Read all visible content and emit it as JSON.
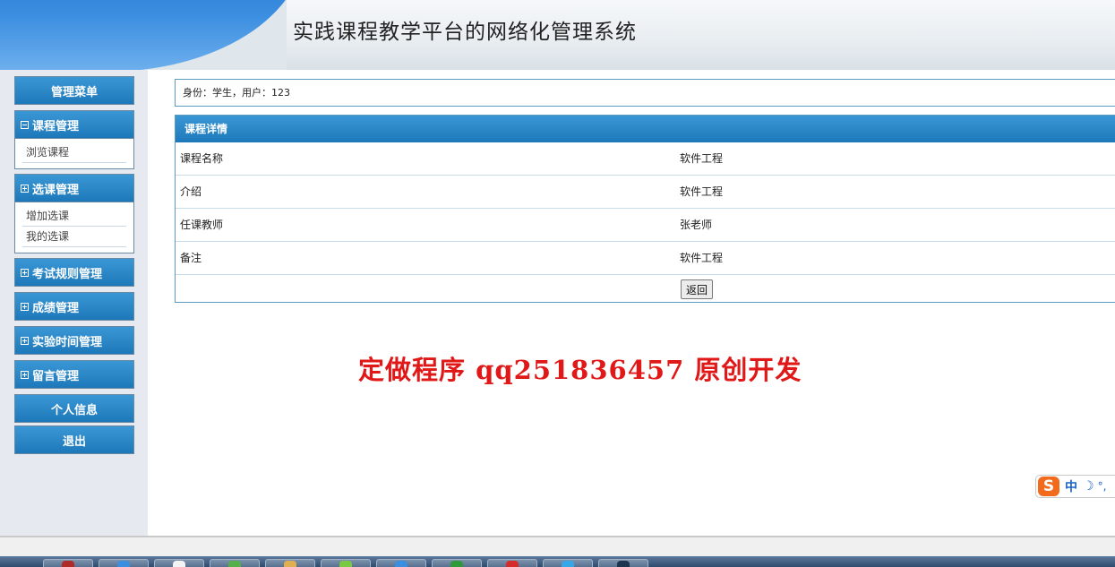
{
  "header": {
    "title": "实践课程教学平台的网络化管理系统"
  },
  "sidebar": {
    "menu_title": "管理菜单",
    "groups": [
      {
        "label": "课程管理",
        "expanded": true,
        "items": [
          "浏览课程"
        ]
      },
      {
        "label": "选课管理",
        "expanded": true,
        "items": [
          "增加选课",
          "我的选课"
        ]
      },
      {
        "label": "考试规则管理",
        "expanded": false
      },
      {
        "label": "成绩管理",
        "expanded": false
      },
      {
        "label": "实验时间管理",
        "expanded": false
      },
      {
        "label": "留言管理",
        "expanded": false
      }
    ],
    "personal_info": "个人信息",
    "logout": "退出"
  },
  "identity": {
    "text": "身份：学生，用户：123"
  },
  "detail": {
    "title": "课程详情",
    "rows": [
      {
        "label": "课程名称",
        "value": "软件工程"
      },
      {
        "label": "介绍",
        "value": "软件工程"
      },
      {
        "label": "任课教师",
        "value": "张老师"
      },
      {
        "label": "备注",
        "value": "软件工程"
      }
    ],
    "back_label": "返回"
  },
  "watermark": "定做程序 qq251836457 原创开发",
  "ime": {
    "logo": "S",
    "mode": "中",
    "moon": "☽",
    "dot": "°,"
  },
  "colors": {
    "accent": "#1d78b9",
    "watermark": "#e01818",
    "ime_logo": "#f26a1b"
  }
}
